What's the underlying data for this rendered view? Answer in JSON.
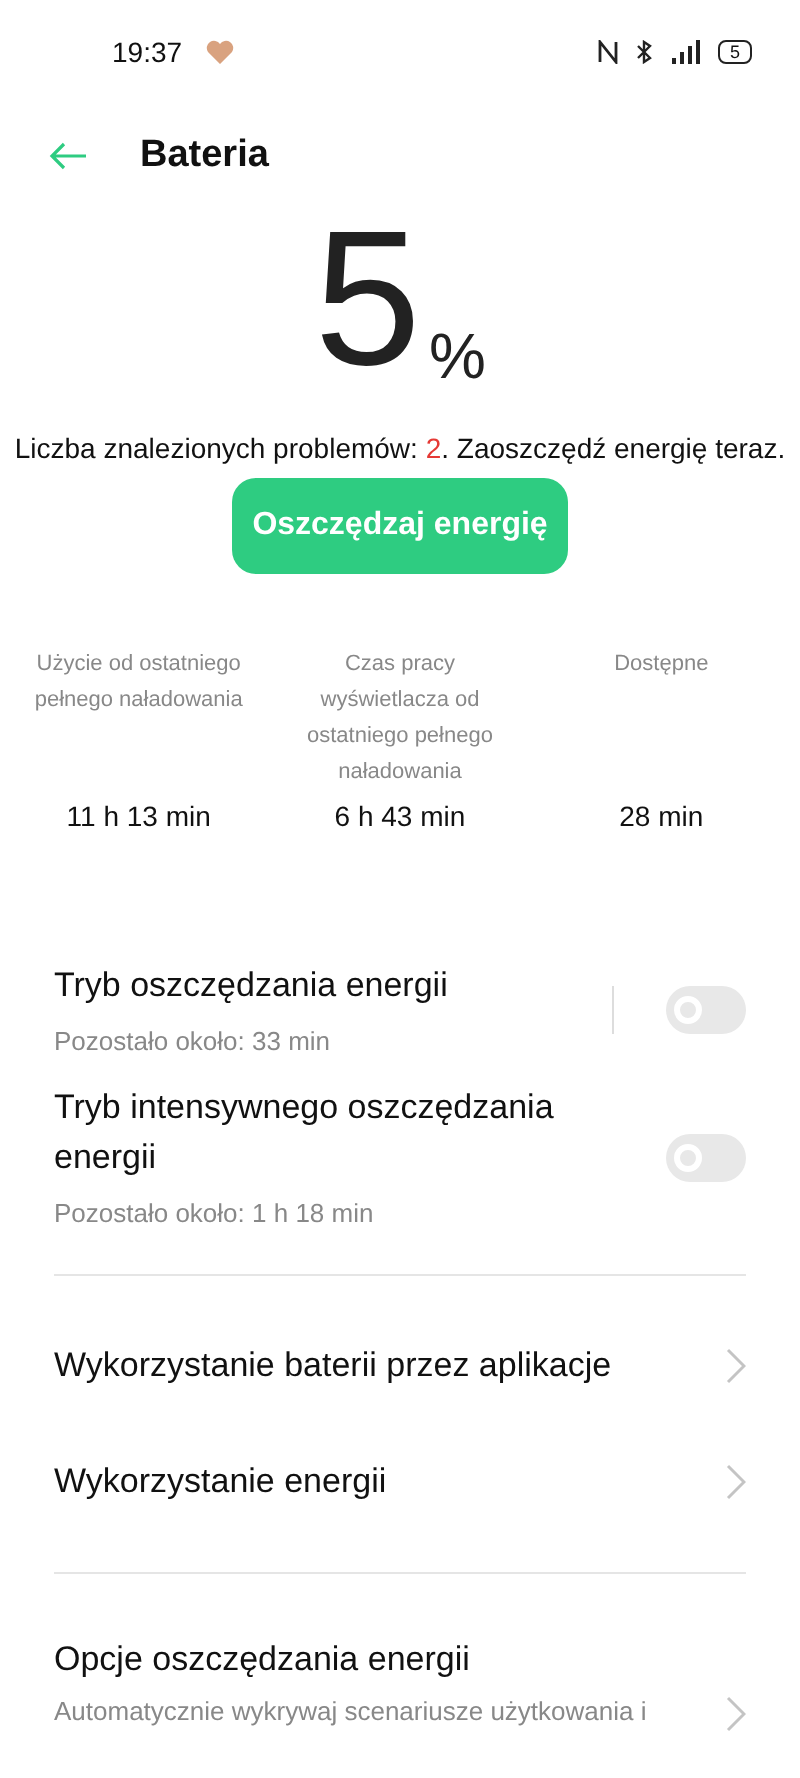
{
  "status_bar": {
    "time": "19:37",
    "battery": "5"
  },
  "header": {
    "title": "Bateria"
  },
  "battery": {
    "value": "5",
    "unit": "%"
  },
  "problems": {
    "prefix": "Liczba znalezionych problemów: ",
    "count": "2",
    "suffix": ". Zaoszczędź energię teraz."
  },
  "save_button": "Oszczędzaj energię",
  "stats": [
    {
      "label": "Użycie od ostatniego pełnego naładowania",
      "value": "11 h 13 min"
    },
    {
      "label": "Czas pracy wyświetlacza od ostatniego pełnego naładowania",
      "value": "6 h 43 min"
    },
    {
      "label": "Dostępne",
      "value": "28 min"
    }
  ],
  "toggles": [
    {
      "title": "Tryb oszczędzania energii",
      "subtitle": "Pozostało około:  33 min",
      "on": false,
      "divider": true
    },
    {
      "title": "Tryb intensywnego oszczędzania energii",
      "subtitle": "Pozostało około:  1 h 18 min",
      "on": false,
      "divider": false
    }
  ],
  "links": [
    {
      "title": "Wykorzystanie baterii przez aplikacje"
    },
    {
      "title": "Wykorzystanie energii"
    }
  ],
  "options": [
    {
      "title": "Opcje oszczędzania energii",
      "subtitle": "Automatycznie wykrywaj scenariusze użytkowania i"
    }
  ]
}
